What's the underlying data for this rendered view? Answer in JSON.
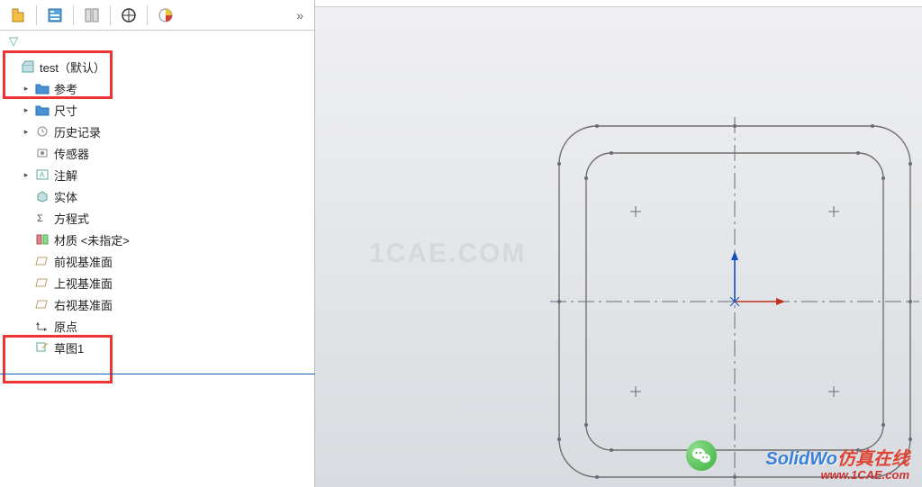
{
  "toolbar": {
    "expand_glyph": "»"
  },
  "filter_icon": "▽",
  "tree": {
    "root": "test（默认）",
    "items": [
      {
        "label": "参考",
        "caret": "▸",
        "icon": "folder"
      },
      {
        "label": "尺寸",
        "caret": "▸",
        "icon": "folder"
      },
      {
        "label": "历史记录",
        "caret": "▸",
        "icon": "history"
      },
      {
        "label": "传感器",
        "caret": "",
        "icon": "sensor"
      },
      {
        "label": "注解",
        "caret": "▸",
        "icon": "annotation"
      },
      {
        "label": "实体",
        "caret": "",
        "icon": "solid"
      },
      {
        "label": "方程式",
        "caret": "",
        "icon": "equation"
      },
      {
        "label": "材质 <未指定>",
        "caret": "",
        "icon": "material"
      },
      {
        "label": "前视基准面",
        "caret": "",
        "icon": "plane"
      },
      {
        "label": "上视基准面",
        "caret": "",
        "icon": "plane"
      },
      {
        "label": "右视基准面",
        "caret": "",
        "icon": "plane"
      },
      {
        "label": "原点",
        "caret": "",
        "icon": "origin"
      },
      {
        "label": "草图1",
        "caret": "",
        "icon": "sketch"
      }
    ]
  },
  "watermarks": {
    "center": "1CAE.COM",
    "brand1": "SolidWo",
    "brand2": "仿真在线",
    "url": "www.1CAE.com"
  },
  "chart_data": {
    "type": "sketch",
    "description": "Two concentric rounded squares centered on origin with construction (dash-dot) centerlines and four offset reference cross marks.",
    "origin": [
      815,
      335
    ],
    "outer_square": {
      "half_width": 195,
      "corner_radius": 42
    },
    "inner_square": {
      "half_width": 165,
      "corner_radius": 28
    },
    "centerlines": {
      "horizontal": true,
      "vertical": true
    },
    "triad": {
      "x_arrow": true,
      "y_arrow": true,
      "color_x": "#d02020",
      "color_y": "#1060d0"
    },
    "cross_marks": [
      [
        -110,
        -100
      ],
      [
        110,
        -100
      ],
      [
        -110,
        100
      ],
      [
        110,
        100
      ]
    ],
    "arc_handles": true
  }
}
